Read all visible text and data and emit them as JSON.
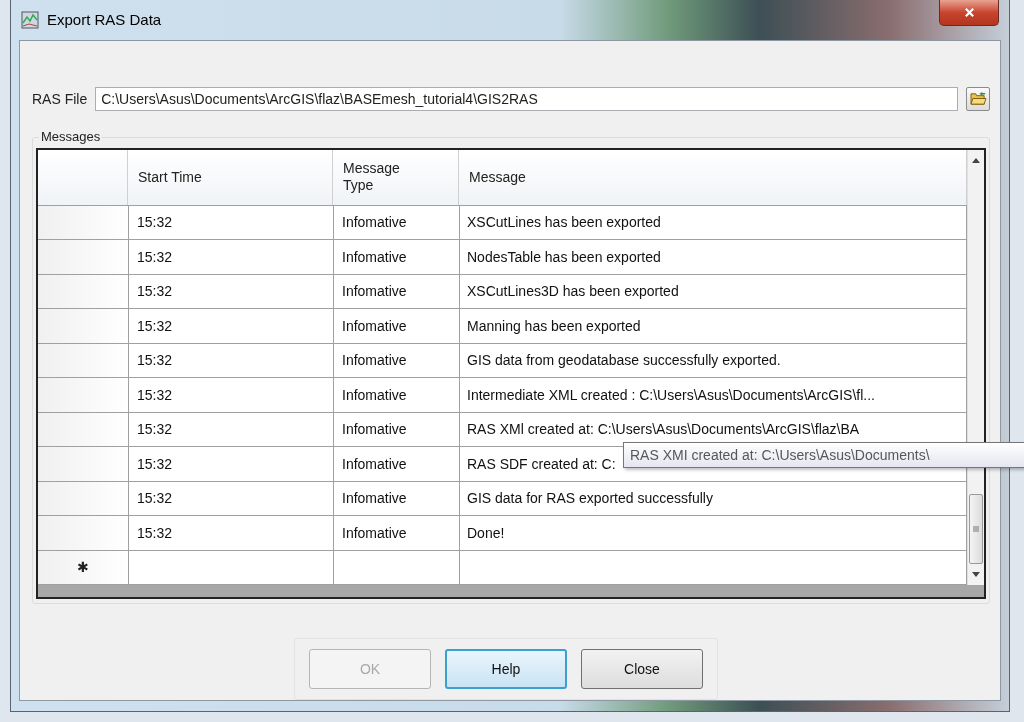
{
  "window": {
    "title": "Export RAS Data"
  },
  "ras_file": {
    "label": "RAS File",
    "value": "C:\\Users\\Asus\\Documents\\ArcGIS\\flaz\\BASEmesh_tutorial4\\GIS2RAS"
  },
  "messages": {
    "label": "Messages",
    "columns": [
      "Start Time",
      "Message Type",
      "Message"
    ],
    "rows": [
      {
        "start_time": "15:32",
        "type": "Infomative",
        "message": "XSCutLines has been exported"
      },
      {
        "start_time": "15:32",
        "type": "Infomative",
        "message": "NodesTable has been exported"
      },
      {
        "start_time": "15:32",
        "type": "Infomative",
        "message": "XSCutLines3D has been exported"
      },
      {
        "start_time": "15:32",
        "type": "Infomative",
        "message": "Manning has been exported"
      },
      {
        "start_time": "15:32",
        "type": "Infomative",
        "message": "GIS data from geodatabase successfully exported."
      },
      {
        "start_time": "15:32",
        "type": "Infomative",
        "message": "Intermediate XML created : C:\\Users\\Asus\\Documents\\ArcGIS\\fl..."
      },
      {
        "start_time": "15:32",
        "type": "Infomative",
        "message": "RAS XMl created at: C:\\Users\\Asus\\Documents\\ArcGIS\\flaz\\BA"
      },
      {
        "start_time": "15:32",
        "type": "Infomative",
        "message": "RAS SDF created at: C:"
      },
      {
        "start_time": "15:32",
        "type": "Infomative",
        "message": "GIS data for RAS exported successfully"
      },
      {
        "start_time": "15:32",
        "type": "Infomative",
        "message": "Done!"
      }
    ],
    "new_row_marker": "✱"
  },
  "tooltip": "RAS XMI created at: C:\\Users\\Asus\\Documents\\",
  "buttons": [
    {
      "label": "OK",
      "disabled": true,
      "focused": false
    },
    {
      "label": "Help",
      "disabled": false,
      "focused": true
    },
    {
      "label": "Close",
      "disabled": false,
      "focused": false
    }
  ]
}
